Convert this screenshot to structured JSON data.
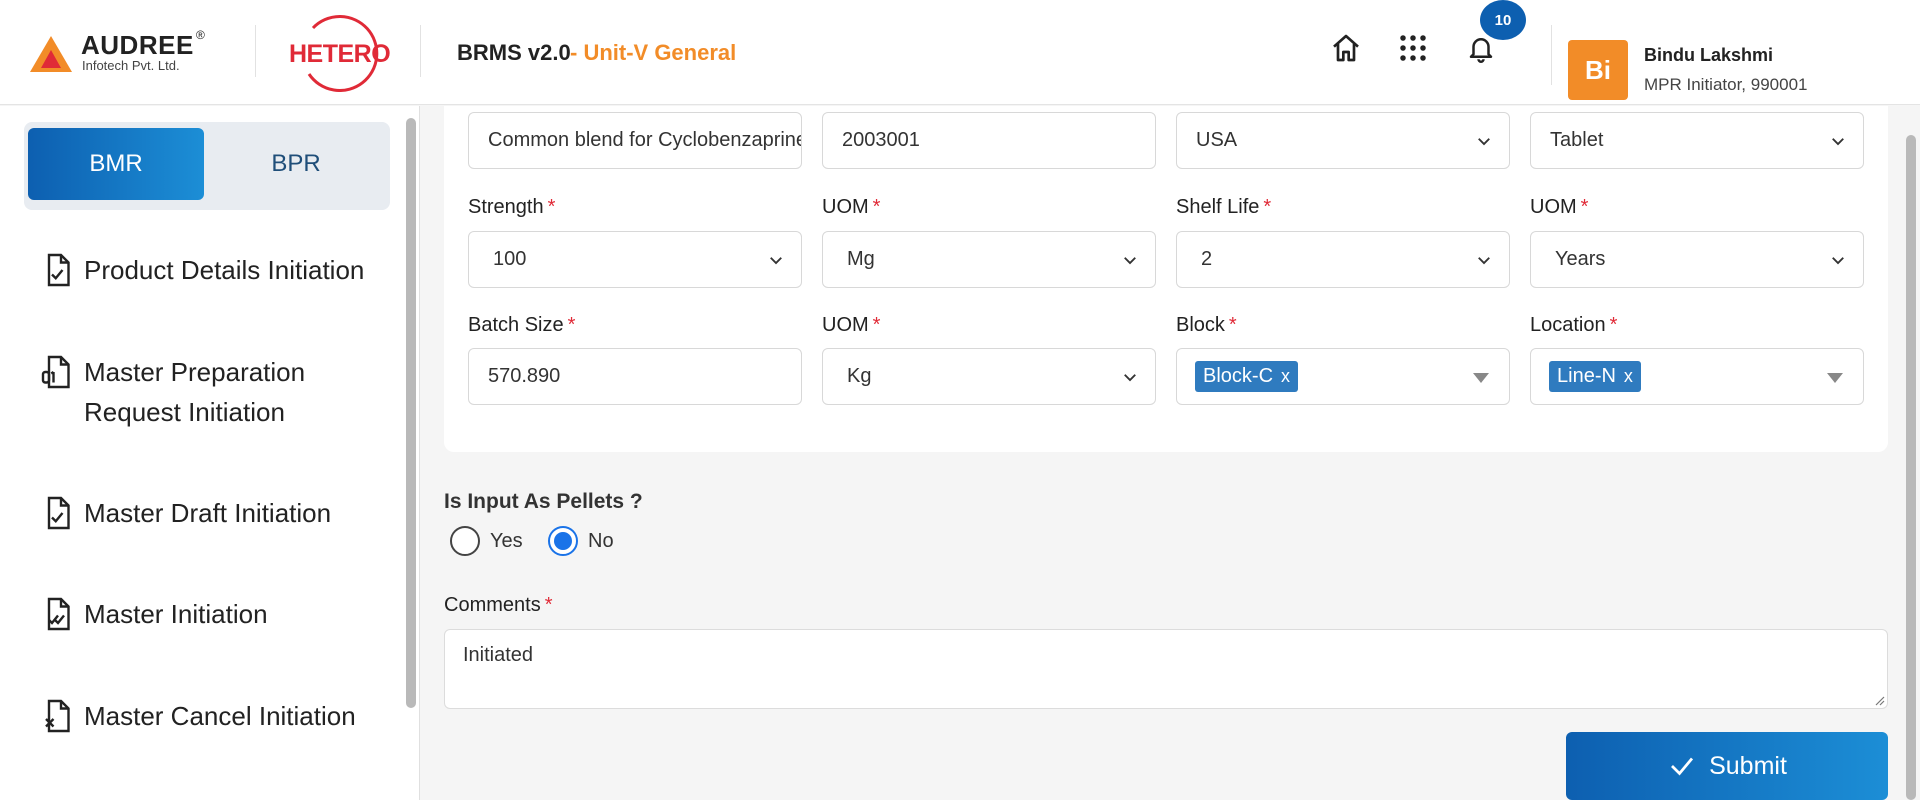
{
  "header": {
    "audree_name": "AUDREE",
    "audree_reg": "®",
    "audree_sub": "Infotech Pvt. Ltd.",
    "hetero_logo": "HETERO",
    "app_title": "BRMS v2.0",
    "app_unit": "- Unit-V General",
    "notification_count": "10",
    "icons": [
      "home-icon",
      "apps-grid-icon",
      "bell-icon"
    ],
    "user": {
      "initials": "Bi",
      "name": "Bindu Lakshmi",
      "role": "MPR Initiator, 990001"
    }
  },
  "sidebar": {
    "tabs": [
      {
        "label": "BMR",
        "active": true
      },
      {
        "label": "BPR",
        "active": false
      }
    ],
    "items": [
      {
        "label": "Product Details Initiation",
        "icon": "document-check-icon"
      },
      {
        "label": "Master Preparation Request Initiation",
        "icon": "document-binary-icon"
      },
      {
        "label": "Master Draft Initiation",
        "icon": "document-check-icon"
      },
      {
        "label": "Master Initiation",
        "icon": "document-double-check-icon"
      },
      {
        "label": "Master Cancel Initiation",
        "icon": "document-cancel-icon"
      }
    ]
  },
  "form": {
    "row0": {
      "product_name": "Common blend for Cyclobenzaprine",
      "product_code": "2003001",
      "market": "USA",
      "dosage_form": "Tablet"
    },
    "strength": {
      "label": "Strength",
      "value": "100"
    },
    "strength_uom": {
      "label": "UOM",
      "value": "Mg"
    },
    "shelf_life": {
      "label": "Shelf Life",
      "value": "2"
    },
    "shelf_life_uom": {
      "label": "UOM",
      "value": "Years"
    },
    "batch_size": {
      "label": "Batch Size",
      "value": "570.890"
    },
    "batch_size_uom": {
      "label": "UOM",
      "value": "Kg"
    },
    "block": {
      "label": "Block",
      "tag": "Block-C",
      "remove": "x"
    },
    "location": {
      "label": "Location",
      "tag": "Line-N",
      "remove": "x"
    },
    "required_mark": "*",
    "pellets": {
      "question": "Is Input As Pellets ?",
      "yes": "Yes",
      "no": "No",
      "selected": "No"
    },
    "comments": {
      "label": "Comments",
      "value": "Initiated"
    },
    "submit_label": "Submit"
  },
  "colors": {
    "primary": "#0d5fb0",
    "accent_orange": "#f28c28",
    "required_red": "#e02a37",
    "tag_blue": "#2f7bbf"
  }
}
